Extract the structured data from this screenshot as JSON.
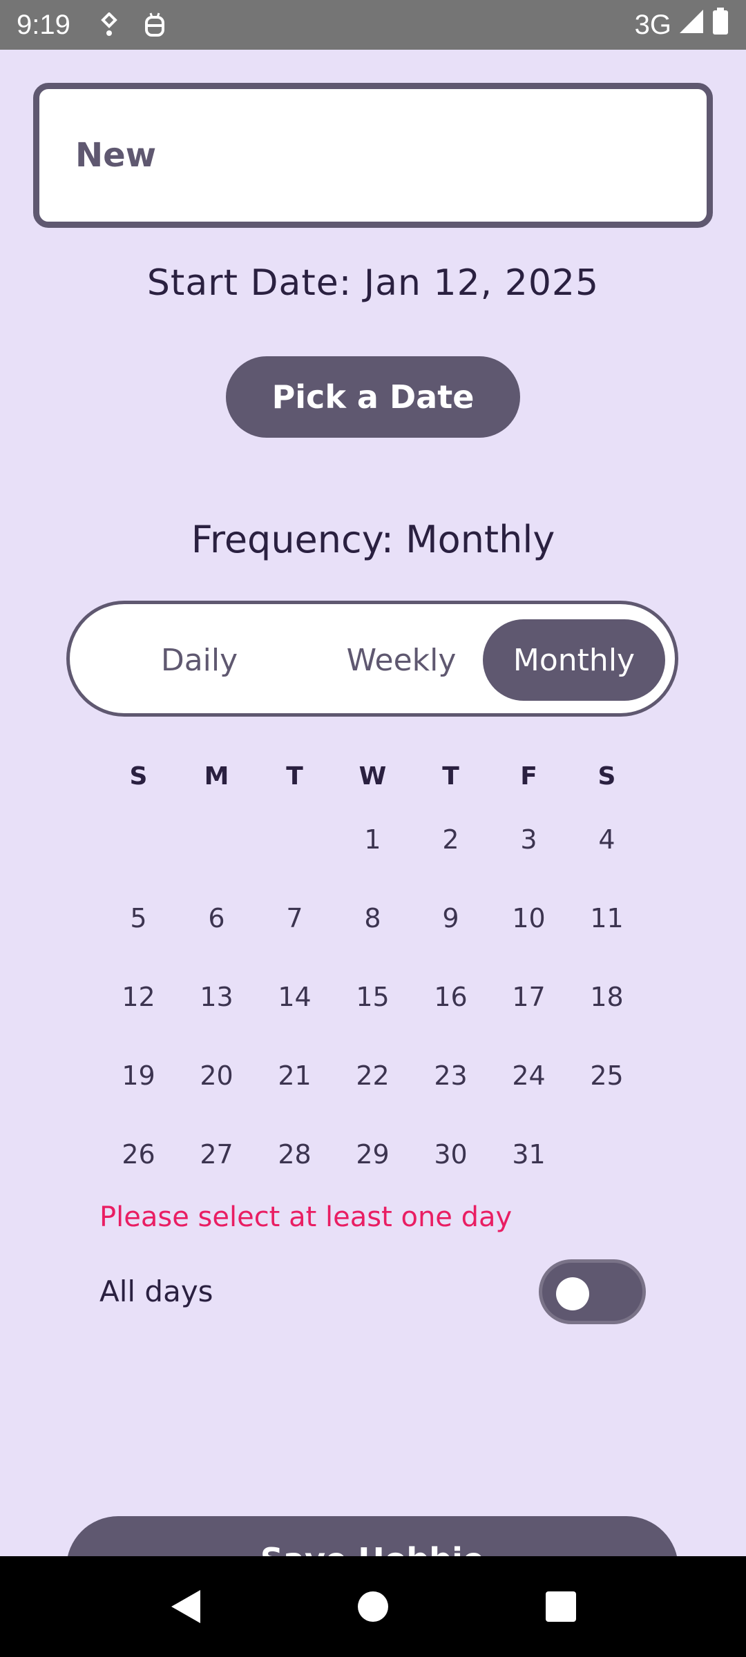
{
  "status_bar": {
    "time": "9:19",
    "network": "3G"
  },
  "habit_name": {
    "value": "New",
    "placeholder": ""
  },
  "start_date": "Start Date: Jan 12, 2025",
  "pick_date_button": "Pick a Date",
  "frequency_label": "Frequency: Monthly",
  "frequency_options": [
    "Daily",
    "Weekly",
    "Monthly"
  ],
  "selected_frequency": "Monthly",
  "calendar": {
    "weekday_headers": [
      "S",
      "M",
      "T",
      "W",
      "T",
      "F",
      "S"
    ],
    "weeks": [
      [
        "",
        "",
        "",
        "1",
        "2",
        "3",
        "4"
      ],
      [
        "5",
        "6",
        "7",
        "8",
        "9",
        "10",
        "11"
      ],
      [
        "12",
        "13",
        "14",
        "15",
        "16",
        "17",
        "18"
      ],
      [
        "19",
        "20",
        "21",
        "22",
        "23",
        "24",
        "25"
      ],
      [
        "26",
        "27",
        "28",
        "29",
        "30",
        "31",
        ""
      ]
    ]
  },
  "error_message": "Please select at least one day",
  "all_days": {
    "label": "All days",
    "enabled": false
  },
  "save_button": "Save Hobbie",
  "colors": {
    "background": "#E8E0F8",
    "accent": "#5F5870",
    "error": "#E91E63"
  }
}
